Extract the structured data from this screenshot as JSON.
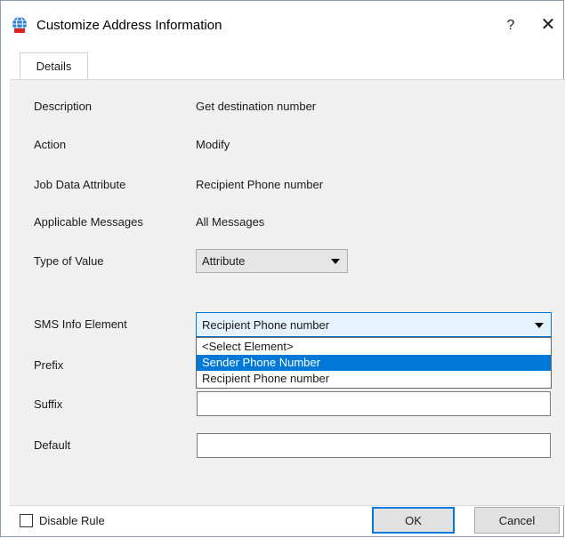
{
  "window": {
    "title": "Customize Address Information",
    "help_glyph": "?",
    "close_glyph": "✕"
  },
  "tabs": [
    {
      "label": "Details"
    }
  ],
  "fields": {
    "description": {
      "label": "Description",
      "value": "Get destination number"
    },
    "action": {
      "label": "Action",
      "value": "Modify"
    },
    "job_data_attribute": {
      "label": "Job Data Attribute",
      "value": "Recipient Phone number"
    },
    "applicable_messages": {
      "label": "Applicable Messages",
      "value": "All Messages"
    },
    "type_of_value": {
      "label": "Type of Value",
      "value": "Attribute"
    },
    "sms_info_element": {
      "label": "SMS Info Element",
      "value": "Recipient Phone number",
      "options": [
        "<Select Element>",
        "Sender Phone Number",
        "Recipient Phone number"
      ],
      "highlighted": "Sender Phone Number"
    },
    "prefix": {
      "label": "Prefix",
      "value": ""
    },
    "suffix": {
      "label": "Suffix",
      "value": ""
    },
    "default": {
      "label": "Default",
      "value": ""
    }
  },
  "footer": {
    "disable_rule_label": "Disable Rule",
    "disable_rule_checked": false,
    "ok_label": "OK",
    "cancel_label": "Cancel"
  },
  "colors": {
    "accent": "#0078d7",
    "panel_bg": "#f0f0f0",
    "highlight_bg": "#e5f1fb"
  }
}
